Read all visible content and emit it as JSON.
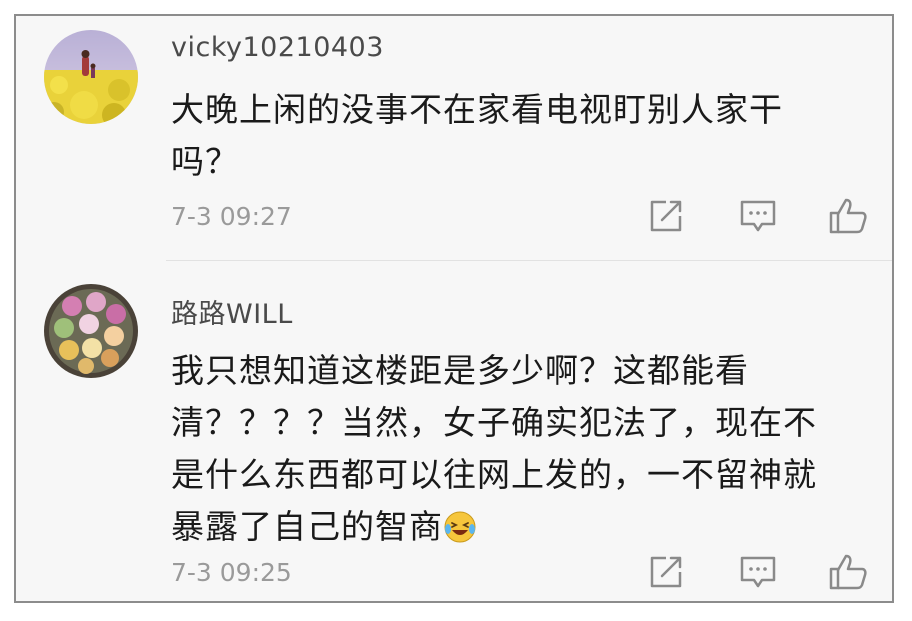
{
  "comments": [
    {
      "username": "vicky10210403",
      "lines": [
        "大晚上闲的没事不在家看电视盯别人家干",
        "吗？"
      ],
      "time": "7-3 09:27",
      "avatar_icon": "yellow-flower-field-avatar"
    },
    {
      "username": "路路WILL",
      "lines": [
        "我只想知道这楼距是多少啊？这都能看",
        "清？？？？当然，女子确实犯法了，现在不",
        "是什么东西都可以往网上发的，一不留神就",
        "暴露了自己的智商"
      ],
      "time": "7-3 09:25",
      "avatar_icon": "steamed-buns-avatar",
      "trailing_emoji": "laughing-crying-emoji"
    }
  ],
  "actions": {
    "share_icon": "share-icon",
    "reply_icon": "comment-icon",
    "like_icon": "thumbs-up-icon"
  },
  "colors": {
    "background": "#f7f7f7",
    "username": "#4a4a4a",
    "body_text": "#1a1a1a",
    "timestamp": "#9a9a9a",
    "icon": "#8a8a8a"
  }
}
